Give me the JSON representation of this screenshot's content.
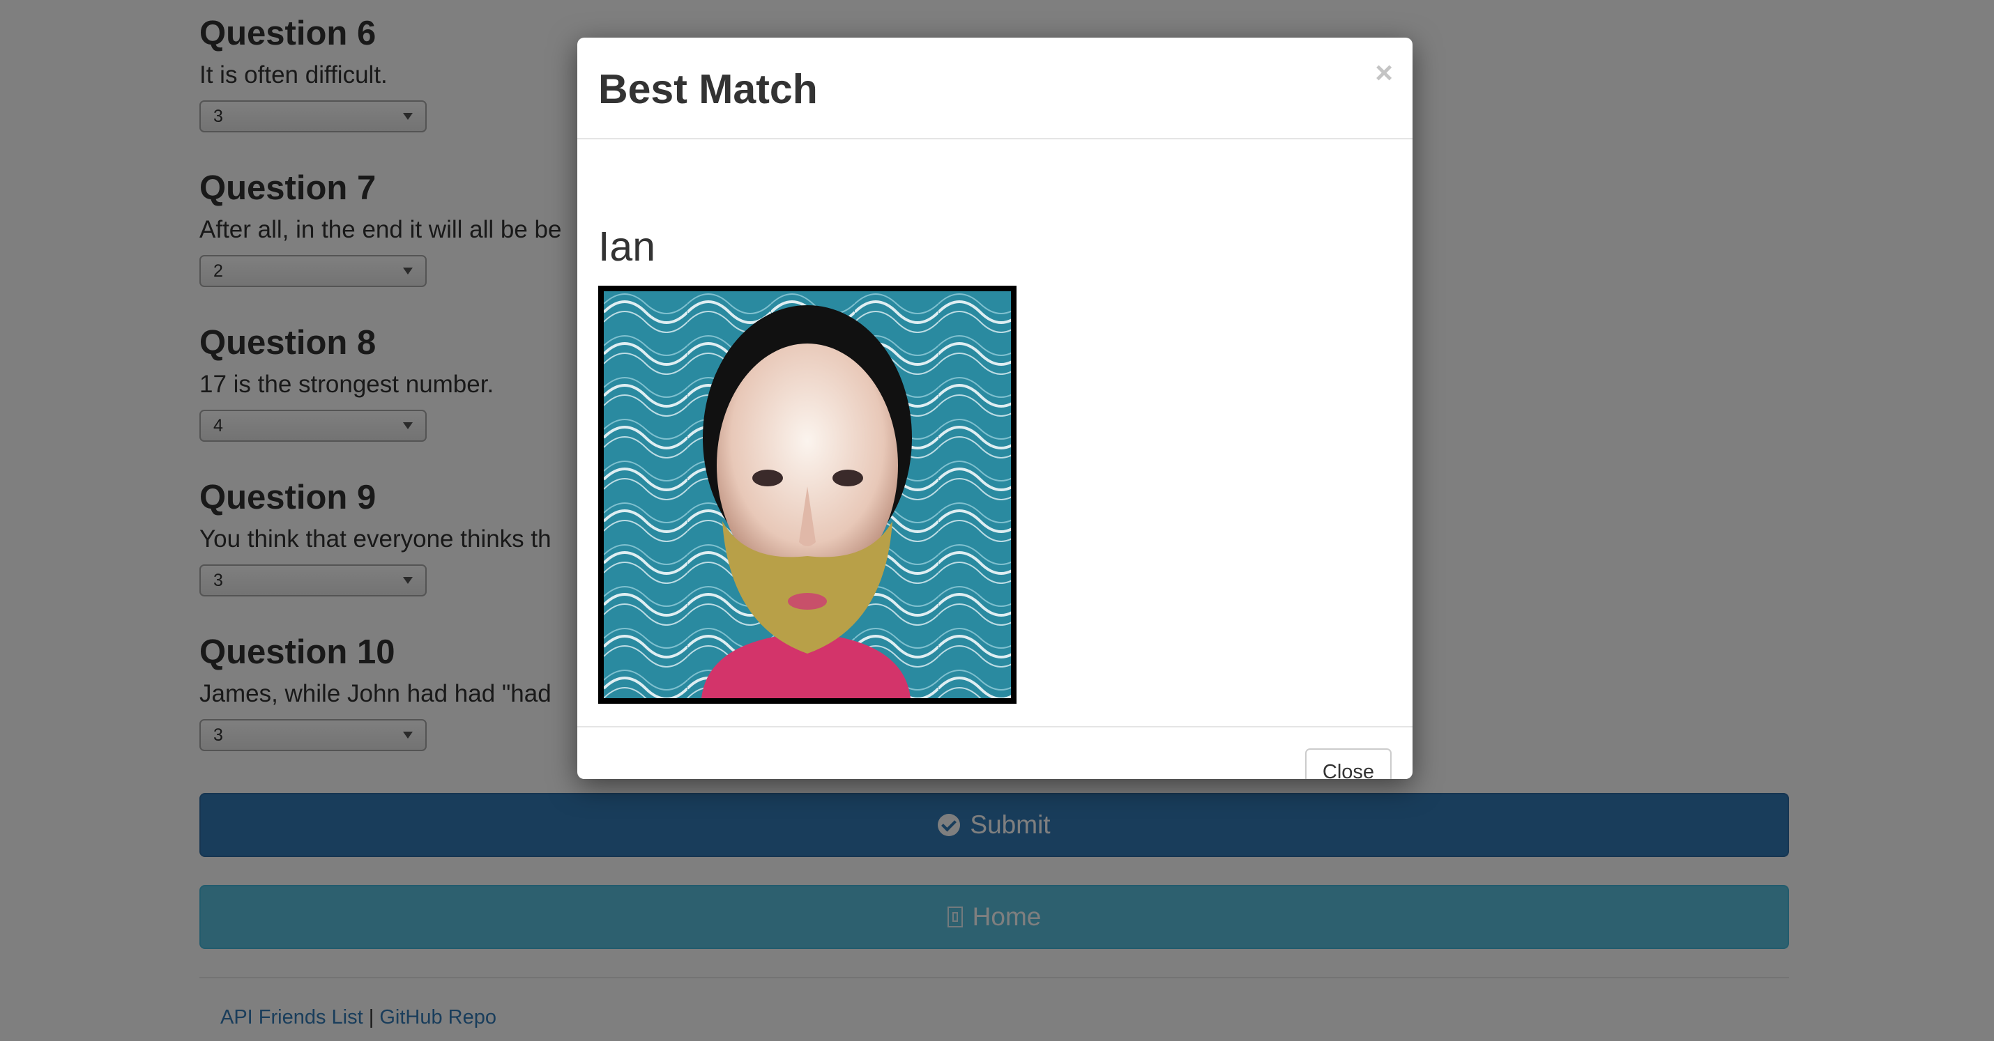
{
  "questions": [
    {
      "title": "Question 6",
      "text": "It is often difficult.",
      "selected": "3"
    },
    {
      "title": "Question 7",
      "text": "After all, in the end it will all be be",
      "selected": "2"
    },
    {
      "title": "Question 8",
      "text": "17 is the strongest number.",
      "selected": "4"
    },
    {
      "title": "Question 9",
      "text": "You think that everyone thinks th",
      "selected": "3"
    },
    {
      "title": "Question 10",
      "text": "James, while John had had \"had",
      "selected": "3"
    }
  ],
  "buttons": {
    "submit_label": "Submit",
    "home_label": "Home"
  },
  "footer": {
    "api_link": "API Friends List",
    "separator": "|",
    "github_link": "GitHub Repo"
  },
  "modal": {
    "title": "Best Match",
    "close_symbol": "×",
    "match_name": "Ian",
    "close_button": "Close"
  },
  "colors": {
    "primary": "#337ab7",
    "info": "#5bc0de",
    "backdrop": "rgba(0,0,0,0.5)"
  }
}
